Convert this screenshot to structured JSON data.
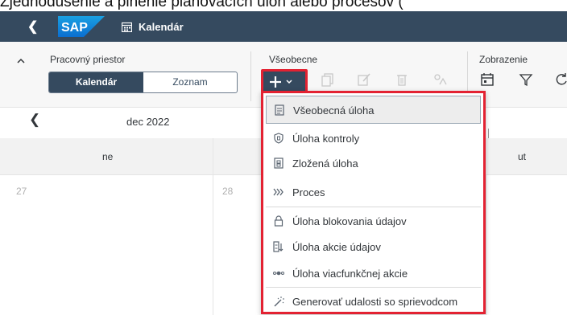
{
  "caption": "Zjednodušenie a plnenie plánovacích úloh alebo procesov (",
  "shell": {
    "logo": "SAP",
    "title": "Kalendár"
  },
  "toolbar": {
    "workspace_label": "Pracovný priestor",
    "segment": {
      "options": [
        "Kalendár",
        "Zoznam"
      ],
      "selected": "Kalendár"
    },
    "general_label": "Všeobecne",
    "display_label": "Zobrazenie"
  },
  "calendar": {
    "month": "dec 2022",
    "day_headers": [
      "ne",
      "ut"
    ],
    "day_numbers": [
      "27",
      "28"
    ]
  },
  "menu": {
    "items": [
      {
        "label": "Všeobecná úloha",
        "icon": "document-icon",
        "selected": true
      },
      {
        "label": "Úloha kontroly",
        "icon": "shield-icon"
      },
      {
        "label": "Zložená úloha",
        "icon": "composite-document-icon"
      },
      {
        "label": "Proces",
        "icon": "chevrons-right-icon"
      },
      {
        "label": "Úloha blokovania údajov",
        "icon": "lock-icon"
      },
      {
        "label": "Úloha akcie údajov",
        "icon": "data-action-icon"
      },
      {
        "label": "Úloha viacfunkčnej akcie",
        "icon": "multi-action-icon"
      },
      {
        "label": "Generovať udalosti so sprievodcom",
        "icon": "wizard-icon"
      }
    ]
  },
  "colors": {
    "shell_bg": "#354a5f",
    "highlight_border": "#e32232",
    "toolbar_bg": "#f7f7f7",
    "calendar_header_bg": "#f2f2f2"
  }
}
